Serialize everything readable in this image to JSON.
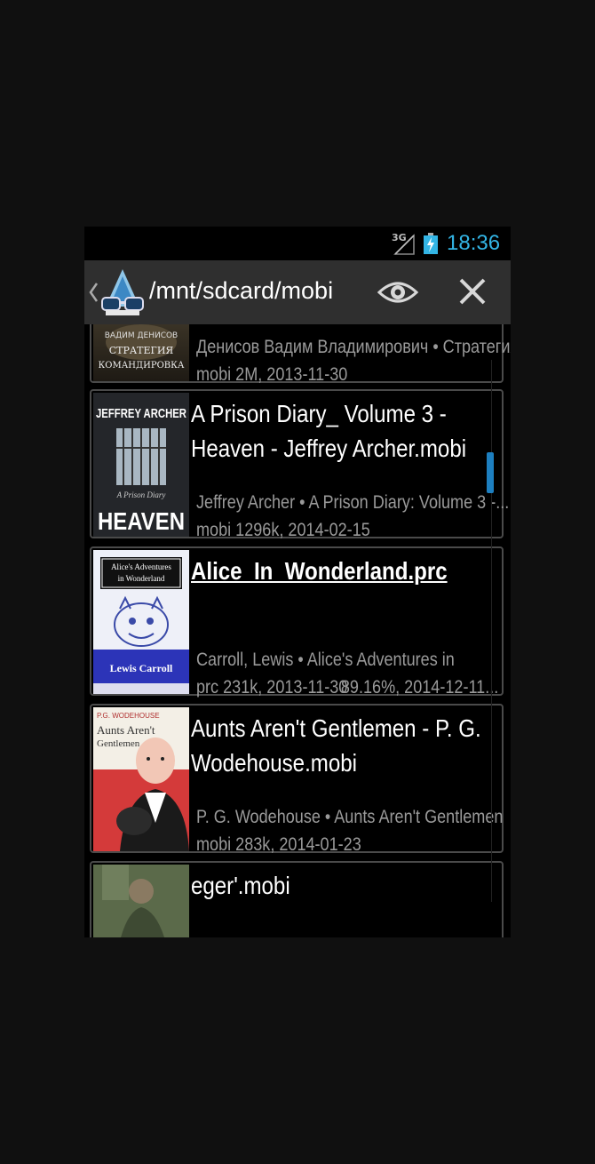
{
  "status": {
    "network": "3G",
    "time": "18:36",
    "accent": "#33b5e5"
  },
  "actionbar": {
    "path": "/mnt/sdcard/mobi",
    "icons": [
      "back-caret-icon",
      "reader-app-icon",
      "eye-icon",
      "close-icon"
    ]
  },
  "books": [
    {
      "title": "",
      "meta": "Денисов Вадим Владимирович • Стратегия....",
      "info": "mobi  2M, 2013-11-30",
      "progress": "",
      "cover": {
        "top": "ВАДИМ ДЕНИСОВ",
        "line1": "СТРАТЕГИЯ",
        "line2": "КОМАНДИРОВКА"
      }
    },
    {
      "title": "A Prison Diary_ Volume 3 - Heaven - Jeffrey Archer.mobi",
      "meta": "Jeffrey Archer • A Prison Diary: Volume 3 -...",
      "info": "mobi  1296k, 2014-02-15",
      "progress": "",
      "cover": {
        "author": "JEFFREY ARCHER",
        "series": "A Prison Diary",
        "title": "HEAVEN"
      }
    },
    {
      "title": "Alice_In_Wonderland.prc",
      "meta": "Carroll, Lewis • Alice's Adventures in",
      "info": "prc  231k, 2013-11-30",
      "progress": "89.16%, 2014-12-11...",
      "cover": {
        "title1": "Alice's Adventures",
        "title2": "in Wonderland",
        "author": "Lewis Carroll"
      }
    },
    {
      "title": "Aunts Aren't Gentlemen - P. G. Wodehouse.mobi",
      "meta": "P. G. Wodehouse • Aunts Aren't Gentlemen",
      "info": "mobi  283k, 2014-01-23",
      "progress": "",
      "cover": {
        "author": "P.G. WODEHOUSE",
        "title1": "Aunts Aren't",
        "title2": "Gentlemen"
      }
    },
    {
      "title": "eger'.mobi",
      "meta": "",
      "info": "",
      "progress": "",
      "cover": {}
    }
  ]
}
